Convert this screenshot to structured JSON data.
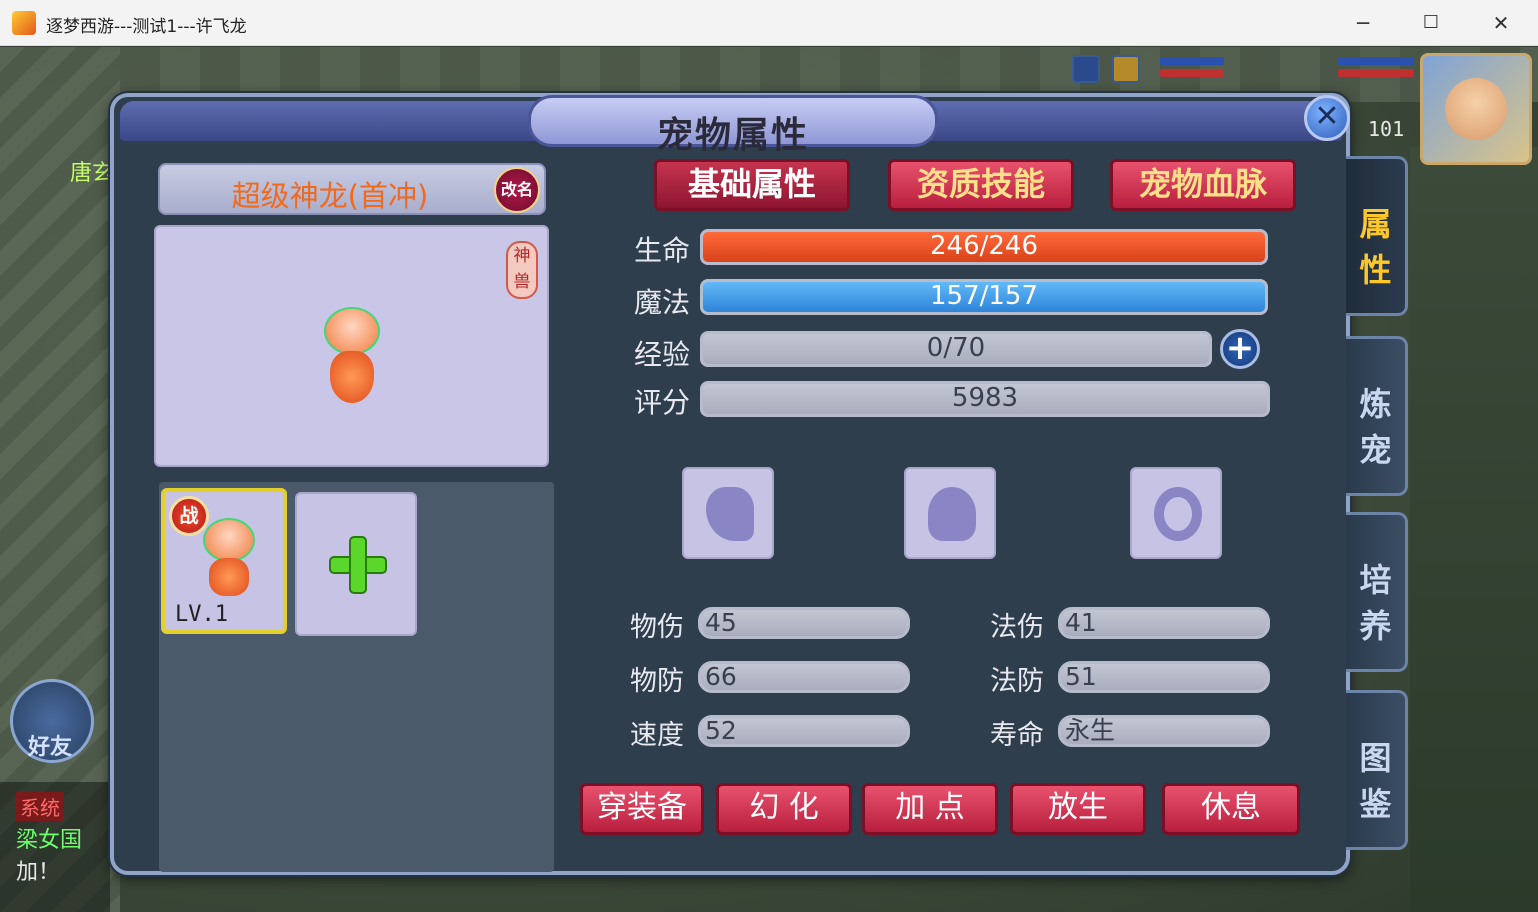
{
  "window": {
    "title": "逐梦西游---测试1---许飞龙",
    "min": "─",
    "max": "☐",
    "close": "✕"
  },
  "hud": {
    "level": "101"
  },
  "background": {
    "npc_text": "唐玄",
    "friend_label": "好友",
    "chat_channel": "系统",
    "chat_lines": [
      "梁女国",
      "加！"
    ]
  },
  "panel": {
    "title": "宠物属性",
    "close_icon": "✕",
    "pet_name": "超级神龙(首冲)",
    "rename": "改名",
    "beast_tag": "神兽",
    "pet_slots": [
      {
        "battle": "战",
        "level": "LV.1"
      }
    ],
    "add_slot_icon": "plus-icon",
    "tabs": [
      "基础属性",
      "资质技能",
      "宠物血脉"
    ],
    "active_tab": 0,
    "stats": {
      "hp_label": "生命",
      "hp": "246/246",
      "hp_fraction": 1.0,
      "mp_label": "魔法",
      "mp": "157/157",
      "mp_fraction": 1.0,
      "exp_label": "经验",
      "exp": "0/70",
      "exp_fraction": 0.0,
      "score_label": "评分",
      "score": "5983"
    },
    "equip_slots": [
      "equip-slot-1",
      "equip-slot-2",
      "equip-slot-3"
    ],
    "attrs": {
      "phys_atk_label": "物伤",
      "phys_atk": "45",
      "mag_atk_label": "法伤",
      "mag_atk": "41",
      "phys_def_label": "物防",
      "phys_def": "66",
      "mag_def_label": "法防",
      "mag_def": "51",
      "speed_label": "速度",
      "speed": "52",
      "life_label": "寿命",
      "life": "永生"
    },
    "actions": [
      "穿装备",
      "幻 化",
      "加 点",
      "放生",
      "休息"
    ]
  },
  "side_tabs": [
    "属性",
    "炼宠",
    "培养",
    "图鉴"
  ],
  "colors": {
    "accent_red": "#b81f3e",
    "hp": "#d9421a",
    "mp": "#2d84d9",
    "active_side": "#ffc82a"
  }
}
